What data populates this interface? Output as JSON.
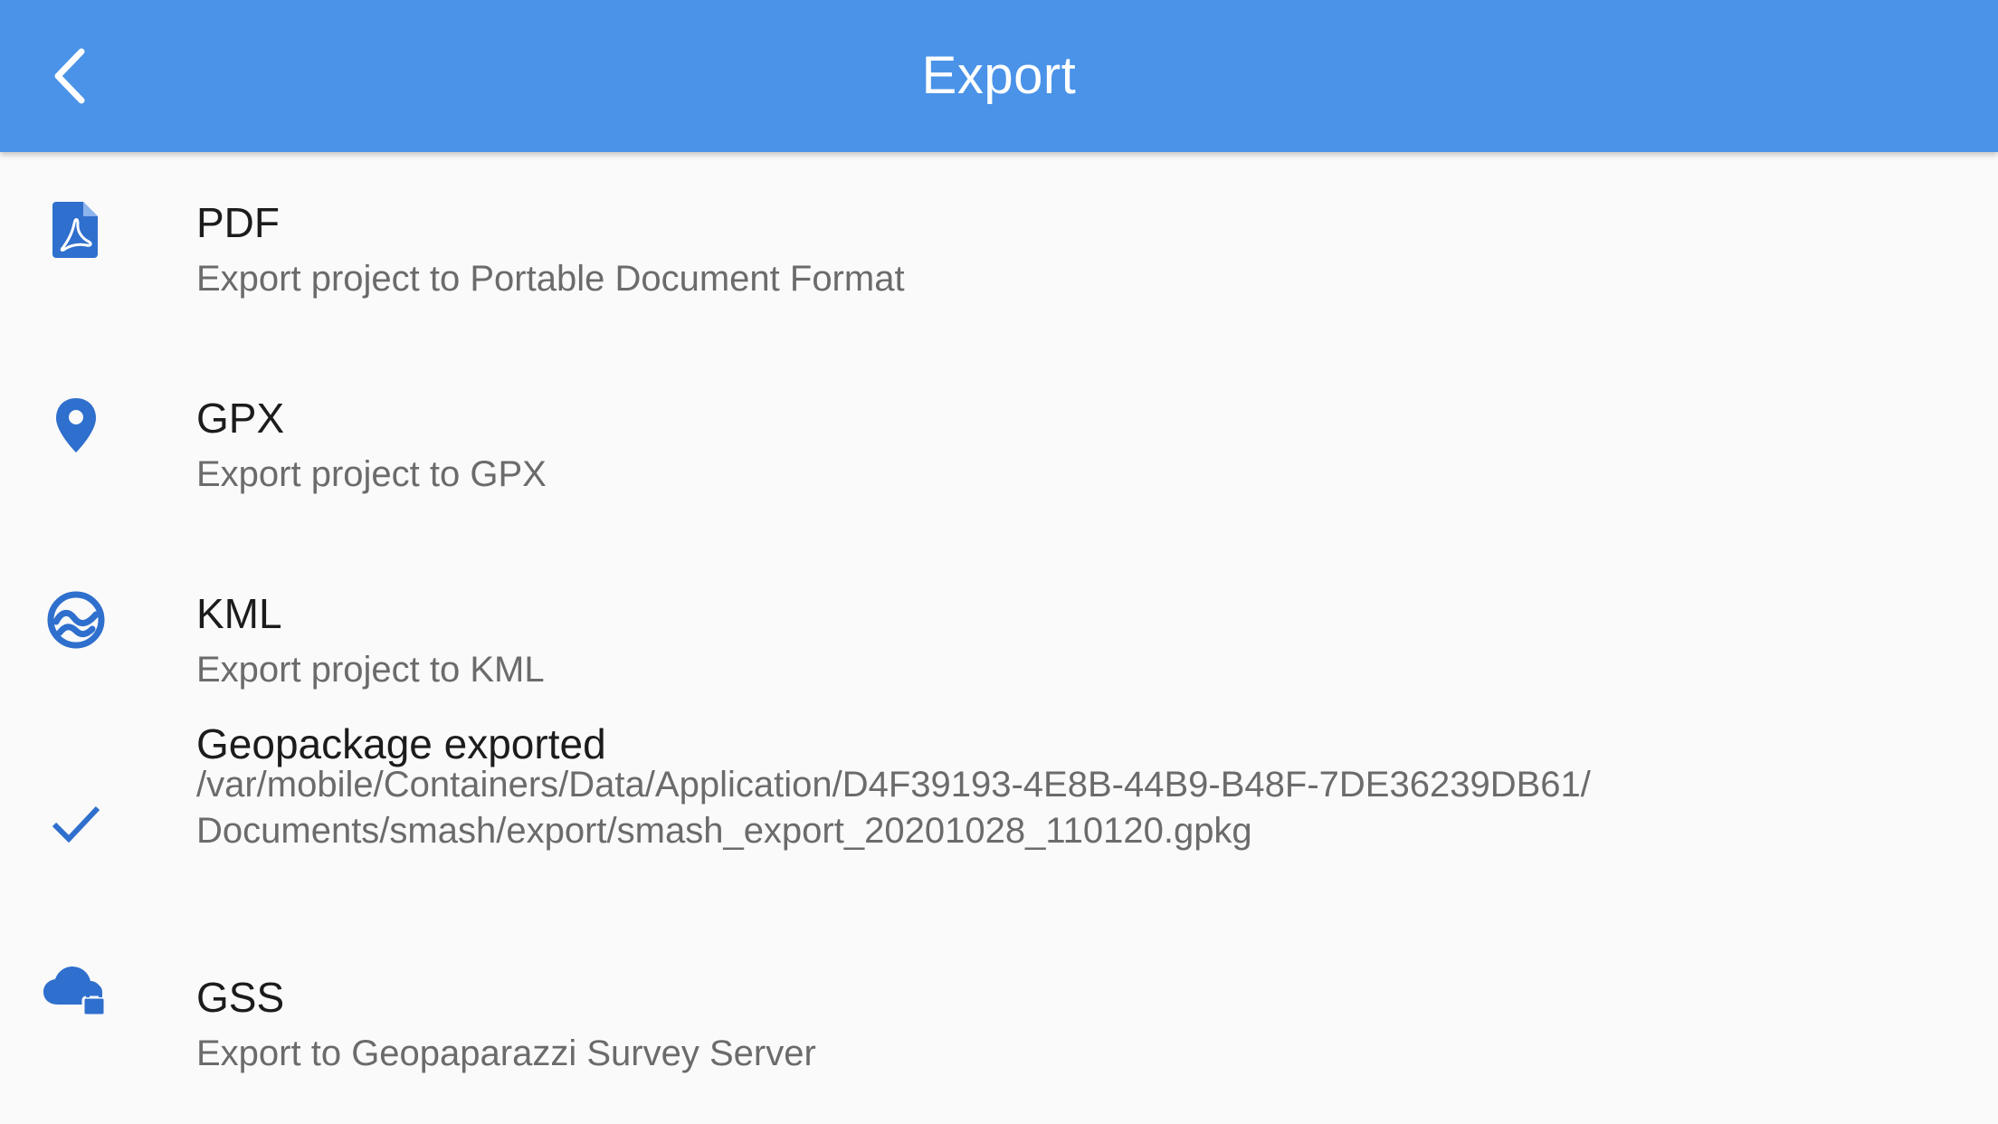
{
  "appbar": {
    "title": "Export",
    "back_icon": "chevron-left-icon",
    "background": "#4a93e8"
  },
  "accent_color": "#2f6fcd",
  "items": [
    {
      "title": "PDF",
      "subtitle": "Export project to Portable Document Format",
      "icon": "pdf-file-icon"
    },
    {
      "title": "GPX",
      "subtitle": "Export project to GPX",
      "icon": "map-marker-icon"
    },
    {
      "title": "KML",
      "subtitle": "Export project to KML",
      "icon": "earth-wave-icon"
    },
    {
      "title": "Geopackage exported",
      "subtitle_line1": "/var/mobile/Containers/Data/Application/D4F39193-4E8B-44B9-B48F-7DE36239DB61/",
      "subtitle_line2": "Documents/smash/export/smash_export_20201028_110120.gpkg",
      "icon": "check-icon"
    },
    {
      "title": "GSS",
      "subtitle": "Export to Geopaparazzi Survey Server",
      "icon": "cloud-lock-icon"
    }
  ]
}
